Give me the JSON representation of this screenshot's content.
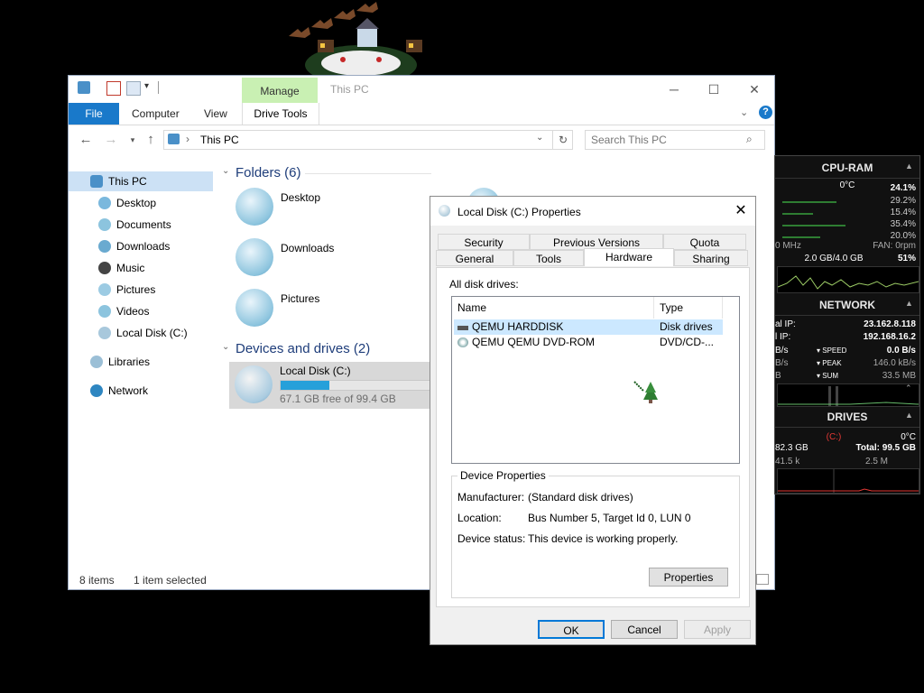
{
  "explorer": {
    "title": "This PC",
    "context_tab": "Manage",
    "ribbon_tabs": [
      "File",
      "Computer",
      "View",
      "Drive Tools"
    ],
    "address": "This PC",
    "search_placeholder": "Search This PC",
    "nav_items": [
      {
        "label": "This PC",
        "icon": "computer-icon"
      },
      {
        "label": "Desktop",
        "icon": "desktop-icon"
      },
      {
        "label": "Documents",
        "icon": "documents-icon"
      },
      {
        "label": "Downloads",
        "icon": "downloads-icon"
      },
      {
        "label": "Music",
        "icon": "music-icon"
      },
      {
        "label": "Pictures",
        "icon": "pictures-icon"
      },
      {
        "label": "Videos",
        "icon": "videos-icon"
      },
      {
        "label": "Local Disk (C:)",
        "icon": "drive-icon"
      },
      {
        "label": "Libraries",
        "icon": "libraries-icon"
      },
      {
        "label": "Network",
        "icon": "network-icon"
      }
    ],
    "folders_header": "Folders (6)",
    "folders": [
      "Desktop",
      "Downloads",
      "Pictures"
    ],
    "devices_header": "Devices and drives (2)",
    "drive": {
      "name": "Local Disk (C:)",
      "free_text": "67.1 GB free of 99.4 GB",
      "used_fraction": 0.325
    },
    "status_items": "8 items",
    "status_selected": "1 item selected"
  },
  "gadget": {
    "cpu_header": "CPU-RAM",
    "cpu_temp": "0°C",
    "cpu_total": "24.1%",
    "cores": [
      "29.2%",
      "15.4%",
      "35.4%",
      "20.0%"
    ],
    "freq": "0 MHz",
    "fan": "FAN: 0rpm",
    "ram": "2.0 GB/4.0 GB",
    "ram_pct": "51%",
    "net_header": "NETWORK",
    "ext_ip_label": "al IP:",
    "ext_ip": "23.162.8.118",
    "int_ip_label": "l IP:",
    "int_ip": "192.168.16.2",
    "speed_label": "SPEED",
    "speed_left": "B/s",
    "speed_val": "0.0 B/s",
    "peak_label": "PEAK",
    "peak_left": "B/s",
    "peak_val": "146.0 kB/s",
    "sum_label": "SUM",
    "sum_left": "B",
    "sum_val": "33.5 MB",
    "drives_header": "DRIVES",
    "drive_letter": "(C:)",
    "drive_temp": "0°C",
    "drive_used": "82.3 GB",
    "drive_total": "Total: 99.5 GB",
    "drive_read": "41.5 k",
    "drive_write": "2.5 M"
  },
  "dialog": {
    "title": "Local Disk (C:) Properties",
    "tabs_row1": [
      "Security",
      "Previous Versions",
      "Quota"
    ],
    "tabs_row2": [
      "General",
      "Tools",
      "Hardware",
      "Sharing"
    ],
    "all_drives_label": "All disk drives:",
    "columns": [
      "Name",
      "Type"
    ],
    "drives": [
      {
        "name": "QEMU HARDDISK",
        "type": "Disk drives"
      },
      {
        "name": "QEMU QEMU DVD-ROM",
        "type": "DVD/CD-..."
      }
    ],
    "device_props_title": "Device Properties",
    "manufacturer_label": "Manufacturer:",
    "manufacturer": "(Standard disk drives)",
    "location_label": "Location:",
    "location": "Bus Number 5, Target Id 0, LUN 0",
    "status_label": "Device status:",
    "status": "This device is working properly.",
    "properties_button": "Properties",
    "ok": "OK",
    "cancel": "Cancel",
    "apply": "Apply"
  }
}
